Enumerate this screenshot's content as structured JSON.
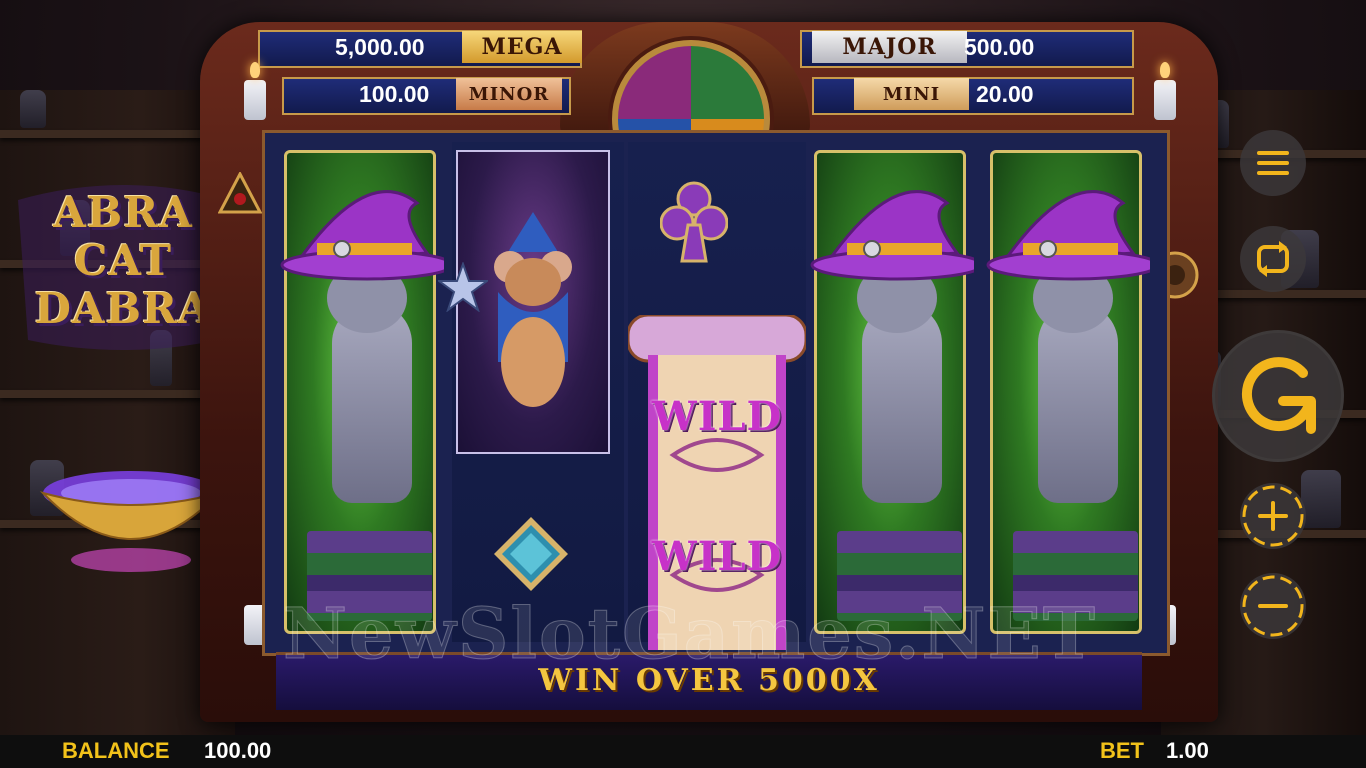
{
  "game": {
    "logo_lines": [
      "ABRA",
      "CAT",
      "DABRA"
    ],
    "logo_tm": "™"
  },
  "jackpots": {
    "mega": {
      "label": "MEGA",
      "value": "5,000.00"
    },
    "major": {
      "label": "MAJOR",
      "value": "500.00"
    },
    "minor": {
      "label": "MINOR",
      "value": "100.00"
    },
    "mini": {
      "label": "MINI",
      "value": "20.00"
    }
  },
  "reels": {
    "symbols": [
      [
        "cat-in-hat"
      ],
      [
        "mouse-wizard",
        "diamond"
      ],
      [
        "club",
        "wild-scroll"
      ],
      [
        "cat-in-hat"
      ],
      [
        "cat-in-hat"
      ]
    ],
    "wild_labels": [
      "WILD",
      "WILD"
    ]
  },
  "banner": {
    "text": "WIN OVER 5000X"
  },
  "watermark": "NewSlotGames.NET",
  "controls": {
    "icons": [
      "menu-icon",
      "autoplay-icon",
      "spin-icon",
      "bet-increase-icon",
      "bet-decrease-icon"
    ],
    "accent": "#f2b51c"
  },
  "status": {
    "balance_label": "BALANCE",
    "balance_value": "100.00",
    "bet_label": "BET",
    "bet_value": "1.00"
  },
  "colors": {
    "frame": "#6b2a1c",
    "reel_bg": "#1b2250",
    "gold": "#f2c21a",
    "wild": "#c732c8"
  }
}
